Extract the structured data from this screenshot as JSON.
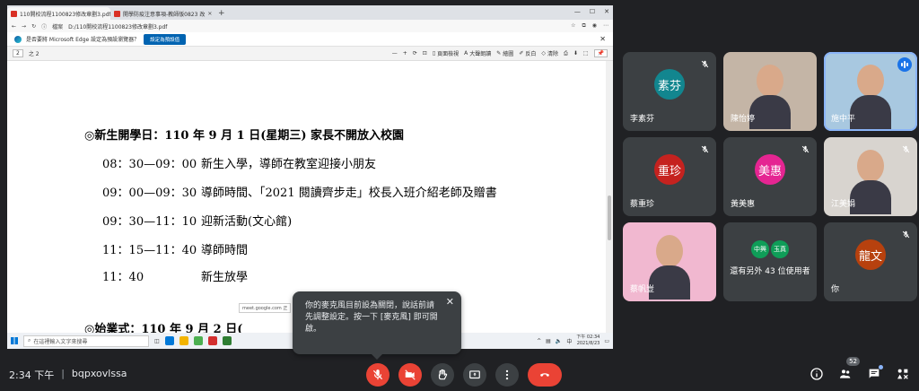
{
  "browser": {
    "tabs": [
      {
        "label": "110開校流程1100823修改章劃3.pdf",
        "active": true
      },
      {
        "label": "開學防疫注意事項-教師版0823 改",
        "active": false
      }
    ],
    "new_tab": "+",
    "address_prefix": "檔案",
    "address": "D:/110開校流程1100823修改章劃3.pdf",
    "banner_text": "是否要將 Microsoft Edge 設定為預設瀏覽器？",
    "banner_button": "設定為預設值",
    "pdf_toolbar": {
      "page_input": "2",
      "page_total": "之 2",
      "zoom_minus": "—",
      "zoom_plus": "+",
      "page_view": "頁面檢視",
      "read_aloud": "大聲朗讀",
      "draw": "繪圖",
      "highlight": "反白",
      "erase": "清除"
    }
  },
  "document": {
    "lines": [
      {
        "time": "◎新生開學日：110 年 9 月 1 日(星期三) 家長不開放入校園",
        "text": "",
        "heading": true
      },
      {
        "time": "08：30—09：00",
        "text": "新生入學，導師在教室迎接小朋友",
        "heading": false
      },
      {
        "time": "09：00—09：30",
        "text": "導師時間、「2021 閱讀齊步走」校長入班介紹老師及贈書",
        "heading": false
      },
      {
        "time": "09：30—11：10",
        "text": "迎新活動(文心館)",
        "heading": false
      },
      {
        "time": "11：15—11：40",
        "text": "導師時間",
        "heading": false
      },
      {
        "time": "11：40",
        "text": "新生放學",
        "heading": false
      },
      {
        "time": "◎始業式：110 年 9 月 2 日(",
        "text": "",
        "heading": true
      }
    ],
    "tooltip": "meet.google.com 正"
  },
  "taskbar": {
    "search_placeholder": "在這裡輸入文字來搜尋",
    "clock_time": "下午 02:34",
    "clock_date": "2021/8/23"
  },
  "participants": [
    {
      "name": "李素芬",
      "initials": "素芬",
      "color": "#12868f",
      "muted": true,
      "video": false
    },
    {
      "name": "陳怡婷",
      "initials": "",
      "color": "#c4b5a6",
      "muted": false,
      "video": true
    },
    {
      "name": "施中平",
      "initials": "",
      "color": "#a8c8e0",
      "muted": false,
      "video": true,
      "speaking": true
    },
    {
      "name": "蔡重珍",
      "initials": "重珍",
      "color": "#c5221f",
      "muted": true,
      "video": false
    },
    {
      "name": "黃美惠",
      "initials": "美惠",
      "color": "#e52592",
      "muted": true,
      "video": false
    },
    {
      "name": "江美娟",
      "initials": "",
      "color": "#d8d4cf",
      "muted": true,
      "video": true
    },
    {
      "name": "蔡帆豈",
      "initials": "",
      "color": "#f1b8d0",
      "muted": false,
      "video": true
    },
    {
      "name": "還有另外 43 位使用者",
      "initials": "",
      "color": "#3c4043",
      "muted": false,
      "video": false,
      "others": [
        "中興",
        "玉真"
      ]
    },
    {
      "name": "你",
      "initials": "龍文",
      "color": "#b7410e",
      "muted": true,
      "video": false
    }
  ],
  "popover": {
    "text": "你的麥克風目前設為關閉，說話前請先調整設定。按一下 [麥克風] 即可開啟。",
    "close": "✕"
  },
  "bottom": {
    "time": "2:34 下午",
    "separator": "|",
    "meeting_code": "bqpxovlssa",
    "people_count": "52"
  },
  "colors": {
    "background": "#202124",
    "tile": "#3c4043",
    "danger": "#ea4335",
    "accent": "#8ab4f8"
  }
}
